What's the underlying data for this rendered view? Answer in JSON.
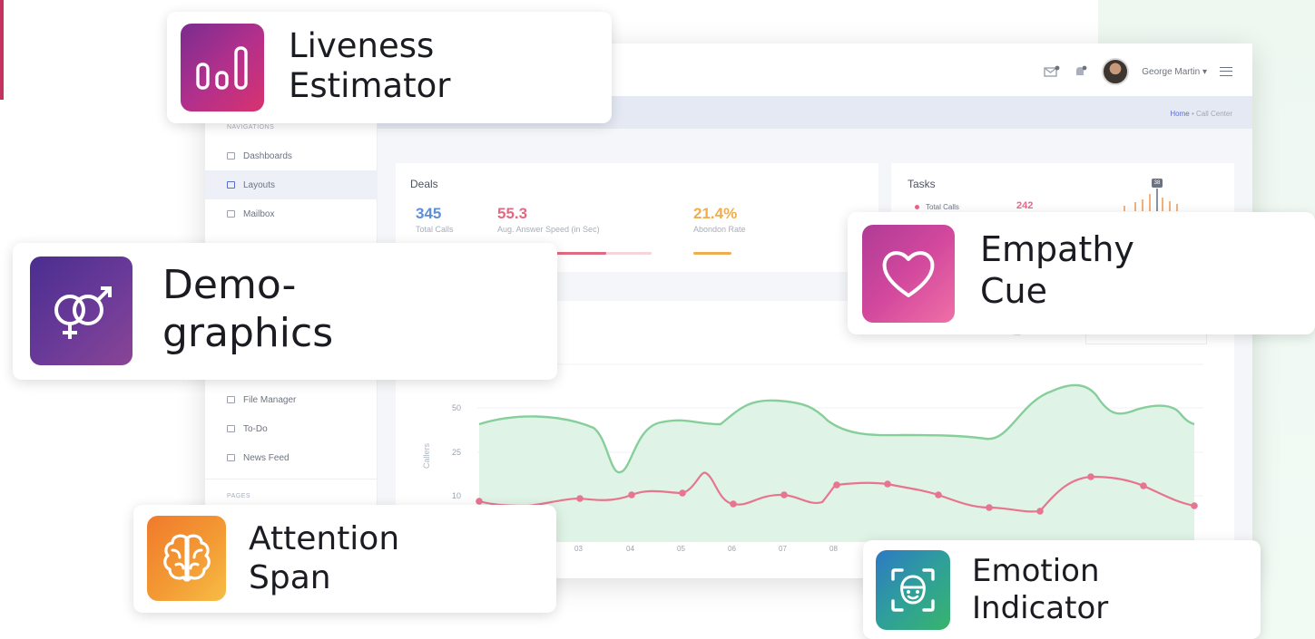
{
  "dashboard": {
    "header": {
      "user_name": "George Martin ▾",
      "icons": [
        "mail-icon",
        "bell-icon",
        "avatar",
        "hamburger-icon"
      ]
    },
    "breadcrumb": {
      "home": "Home",
      "separator": "•",
      "current": "Call Center"
    },
    "sidebar": {
      "navigations_heading": "NAVIGATIONS",
      "items_top": [
        {
          "label": "Dashboards",
          "icon": "grid-icon"
        },
        {
          "label": "Layouts",
          "icon": "layout-icon",
          "active": true
        },
        {
          "label": "Mailbox",
          "icon": "mail-icon"
        }
      ],
      "items_bottom": [
        {
          "label": "File Manager",
          "icon": "folder-icon"
        },
        {
          "label": "To-Do",
          "icon": "clipboard-icon"
        },
        {
          "label": "News Feed",
          "icon": "newspaper-icon"
        }
      ],
      "pages_heading": "PAGES"
    },
    "deals": {
      "title": "Deals",
      "stats": [
        {
          "value": "345",
          "label": "Total Calls",
          "color": "#5c8fd6"
        },
        {
          "value": "55.3",
          "label": "Aug. Answer Speed (in Sec)",
          "color": "#e06a82"
        },
        {
          "value": "21.4%",
          "label": "Abondon Rate",
          "color": "#f0ad4e"
        }
      ]
    },
    "tasks": {
      "title": "Tasks",
      "total_calls_label": "Total Calls",
      "total_calls_value": "242",
      "badge": "38"
    },
    "chart": {
      "y_axis_label": "Callers",
      "y_ticks": [
        "50",
        "25",
        "10"
      ],
      "x_ticks": [
        "03",
        "04",
        "05",
        "06",
        "07",
        "08"
      ]
    }
  },
  "features": {
    "liveness": {
      "label": "Liveness\nEstimator",
      "icon": "bar-chart-icon"
    },
    "demographics": {
      "label": "Demo-\ngraphics",
      "icon": "gender-icon"
    },
    "empathy": {
      "label": "Empathy\nCue",
      "icon": "heart-icon"
    },
    "attention": {
      "label": "Attention\nSpan",
      "icon": "brain-icon"
    },
    "emotion": {
      "label": "Emotion\nIndicator",
      "icon": "face-scan-icon"
    }
  },
  "colors": {
    "green_fill": "#d8f1e1",
    "green_line": "#7fcc96",
    "pink_line": "#e8758f"
  }
}
